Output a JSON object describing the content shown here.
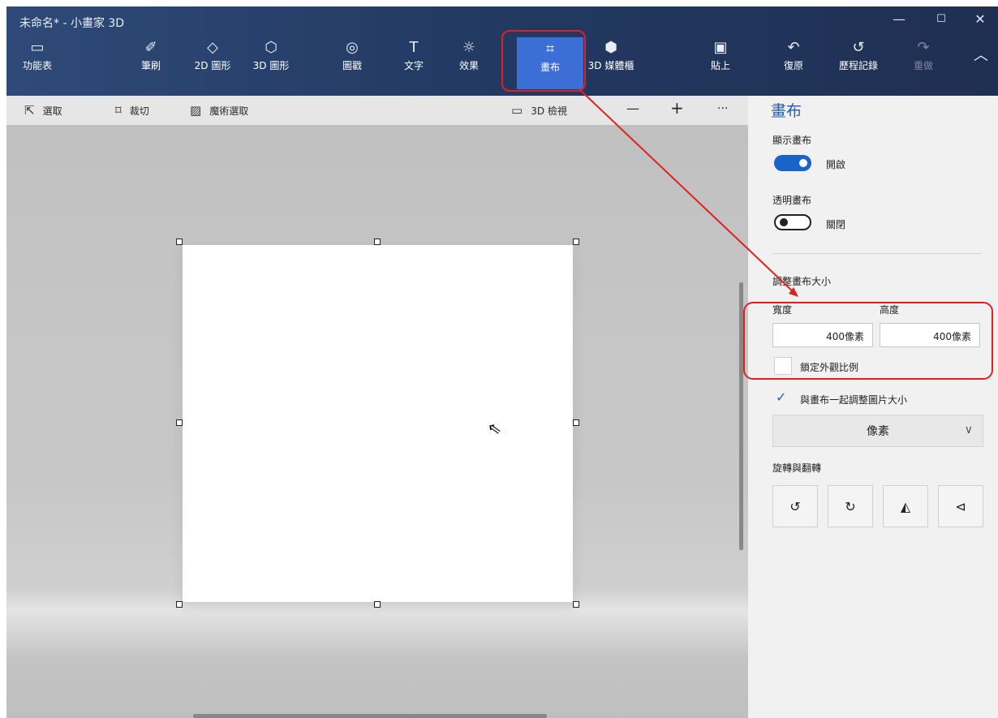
{
  "window": {
    "title": "未命名* - 小畫家 3D",
    "minimize": "—",
    "maximize": "☐",
    "close": "✕"
  },
  "tools": {
    "menu": {
      "label": "功能表",
      "icon": "folder-icon"
    },
    "brushes": {
      "label": "筆刷",
      "icon": "brush-icon"
    },
    "shapes2d": {
      "label": "2D 圖形",
      "icon": "2d-shapes-icon"
    },
    "shapes3d": {
      "label": "3D 圖形",
      "icon": "3d-shapes-icon"
    },
    "stickers": {
      "label": "圖戳",
      "icon": "sticker-icon"
    },
    "text": {
      "label": "文字",
      "icon": "text-icon"
    },
    "effects": {
      "label": "效果",
      "icon": "effects-icon"
    },
    "canvas": {
      "label": "畫布",
      "icon": "canvas-icon"
    },
    "library3d": {
      "label": "3D 媒體櫃",
      "icon": "3d-library-icon"
    },
    "paste": {
      "label": "貼上",
      "icon": "paste-icon"
    },
    "undo": {
      "label": "復原",
      "icon": "undo-icon"
    },
    "history": {
      "label": "歷程記錄",
      "icon": "history-icon"
    },
    "redo": {
      "label": "重做",
      "icon": "redo-icon"
    },
    "collapse": {
      "icon": "chevron-up-icon"
    }
  },
  "subbar": {
    "select": "選取",
    "crop": "裁切",
    "magic_select": "魔術選取",
    "view3d": "3D 檢視",
    "zoom_out": "—",
    "zoom_in": "+",
    "more": "···"
  },
  "panel": {
    "title": "畫布",
    "show_canvas_label": "顯示畫布",
    "show_canvas_state": "開啟",
    "transparent_label": "透明畫布",
    "transparent_state": "關閉",
    "resize_label": "調整畫布大小",
    "width_label": "寬度",
    "height_label": "高度",
    "width_value": "400像素",
    "height_value": "400像素",
    "lock_ratio_label": "鎖定外觀比例",
    "resize_image_label": "與畫布一起調整圖片大小",
    "unit_value": "像素",
    "rotate_flip_label": "旋轉與翻轉"
  },
  "accent": "#1a63c8",
  "annotation_color": "#e02020"
}
